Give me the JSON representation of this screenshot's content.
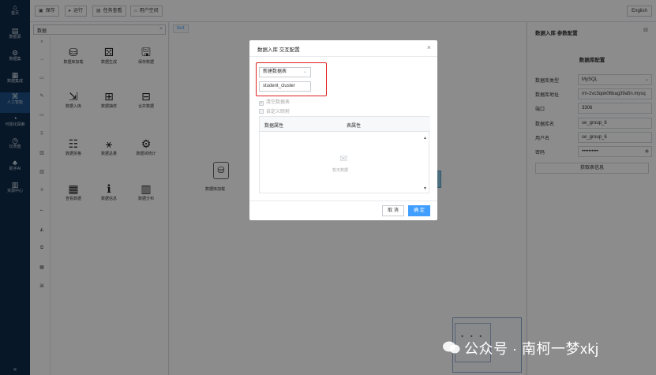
{
  "nav": {
    "items": [
      {
        "icon": "⌂",
        "label": "首页"
      },
      {
        "icon": "▤",
        "label": "数据源"
      },
      {
        "icon": "⚙",
        "label": "数据集"
      },
      {
        "icon": "▦",
        "label": "数据集成"
      },
      {
        "icon": "⌘",
        "label": "人工智能"
      },
      {
        "icon": "◔",
        "label": "可视化探索"
      },
      {
        "icon": "◷",
        "label": "仪表盘"
      },
      {
        "icon": "♣",
        "label": "助手AI"
      },
      {
        "icon": "▥",
        "label": "资源中心"
      }
    ],
    "collapse_label": "«"
  },
  "toolbar": {
    "save": {
      "icon": "▣",
      "label": "保存"
    },
    "run": {
      "icon": "▸",
      "label": "运行"
    },
    "tasks": {
      "icon": "▤",
      "label": "任务查看"
    },
    "user_space": {
      "icon": "⌂",
      "label": "用户空间"
    },
    "language": "English"
  },
  "panel": {
    "search_text": "数据",
    "categories": [
      "⌕",
      "→",
      "▭",
      "✎",
      "▭",
      "⠿",
      "▥",
      "▥",
      "≡",
      "⌙",
      "◭",
      "⧉",
      "▦",
      "⌘"
    ],
    "components": [
      {
        "icon": "⛁",
        "label": "数据库加载"
      },
      {
        "icon": "⚄",
        "label": "数据生成"
      },
      {
        "icon": "🖫",
        "label": "保存数据"
      },
      {
        "icon": "⇲",
        "label": "数据入库"
      },
      {
        "icon": "⊞",
        "label": "数据抽样"
      },
      {
        "icon": "⊟",
        "label": "合并数据"
      },
      {
        "icon": "☷",
        "label": "数据拆格"
      },
      {
        "icon": "⚹",
        "label": "数据总量"
      },
      {
        "icon": "⚙",
        "label": "数据间统计"
      },
      {
        "icon": "▦",
        "label": "查看数据"
      },
      {
        "icon": "ℹ",
        "label": "数据信息"
      },
      {
        "icon": "▥",
        "label": "数据分布"
      }
    ]
  },
  "canvas": {
    "tab": "test",
    "node_label": "数据库加载",
    "node_icon": "⛁"
  },
  "right_panel": {
    "title": "数据入库 参数配置",
    "section": "数据库配置",
    "fields": [
      {
        "label": "数据库类型",
        "value": "MySQL",
        "suffix": "⌄"
      },
      {
        "label": "数据库地址",
        "value": "rm-2vc3qok06bag39a5n.mysq",
        "suffix": ""
      },
      {
        "label": "端口",
        "value": "3306",
        "suffix": ""
      },
      {
        "label": "数据库名",
        "value": "se_group_6",
        "suffix": ""
      },
      {
        "label": "用户名",
        "value": "se_group_6",
        "suffix": ""
      },
      {
        "label": "密码",
        "value": "••••••••••",
        "suffix": "◉"
      }
    ],
    "fetch_button": "获取表信息"
  },
  "modal": {
    "title": "数据入库 交互配置",
    "close": "×",
    "select_value": "新建数据表",
    "table_name": "student_cluster",
    "check_clear": "清空数据表",
    "check_custom": "自定义映射",
    "col_data": "数据属性",
    "col_table": "表属性",
    "empty_text": "暂无数据",
    "cancel": "取 消",
    "ok": "确 定"
  },
  "watermark": "公众号 · 南柯一梦xkj",
  "colors": {
    "nav_bg": "#0f2a47",
    "accent": "#409eff",
    "highlight": "#e02020"
  }
}
